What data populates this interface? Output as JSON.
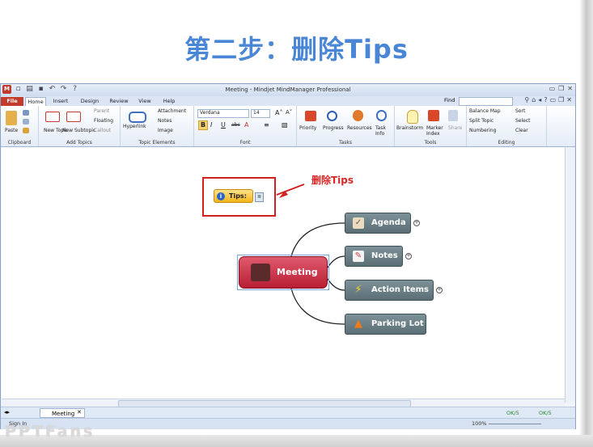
{
  "slide": {
    "title": "第二步：删除Tips",
    "watermark": "PPTFans",
    "annotation": "删除Tips"
  },
  "window": {
    "title": "Meeting - Mindjet MindManager Professional",
    "find_label": "Find"
  },
  "tabs": [
    "File",
    "Home",
    "Insert",
    "Design",
    "Review",
    "View",
    "Help"
  ],
  "ribbon": {
    "clipboard": {
      "paste": "Paste",
      "label": "Clipboard"
    },
    "add_topics": {
      "new_topic": "New Topic",
      "new_subtopic": "New Subtopic",
      "parent": "Parent",
      "floating": "Floating",
      "callout": "Callout",
      "label": "Add Topics"
    },
    "topic_elements": {
      "hyperlink": "Hyperlink",
      "attachment": "Attachment",
      "notes": "Notes",
      "image": "Image",
      "label": "Topic Elements"
    },
    "font": {
      "family": "Verdana",
      "size": "14",
      "label": "Font"
    },
    "tasks": {
      "priority": "Priority",
      "progress": "Progress",
      "resources": "Resources",
      "task_info": "Task Info",
      "label": "Tasks"
    },
    "tools": {
      "brainstorm": "Brainstorm",
      "marker_index": "Marker Index",
      "share": "Share",
      "label": "Tools"
    },
    "editing": {
      "balance_map": "Balance Map",
      "split_topic": "Split Topic",
      "numbering": "Numbering",
      "sort": "Sort",
      "select": "Select",
      "clear": "Clear",
      "label": "Editing"
    }
  },
  "map": {
    "tips": "Tips:",
    "central": "Meeting",
    "topics": [
      "Agenda",
      "Notes",
      "Action Items",
      "Parking Lot"
    ]
  },
  "doc_tab": "Meeting",
  "status": {
    "sign_in": "Sign In",
    "ok1": "OK/5",
    "ok2": "OK/5",
    "zoom": "100%"
  },
  "colors": {
    "title": "#4a86d6",
    "annotation": "#d82828",
    "central": "#c0263b",
    "subtopic": "#6c8187",
    "tips": "#f5c33b"
  }
}
